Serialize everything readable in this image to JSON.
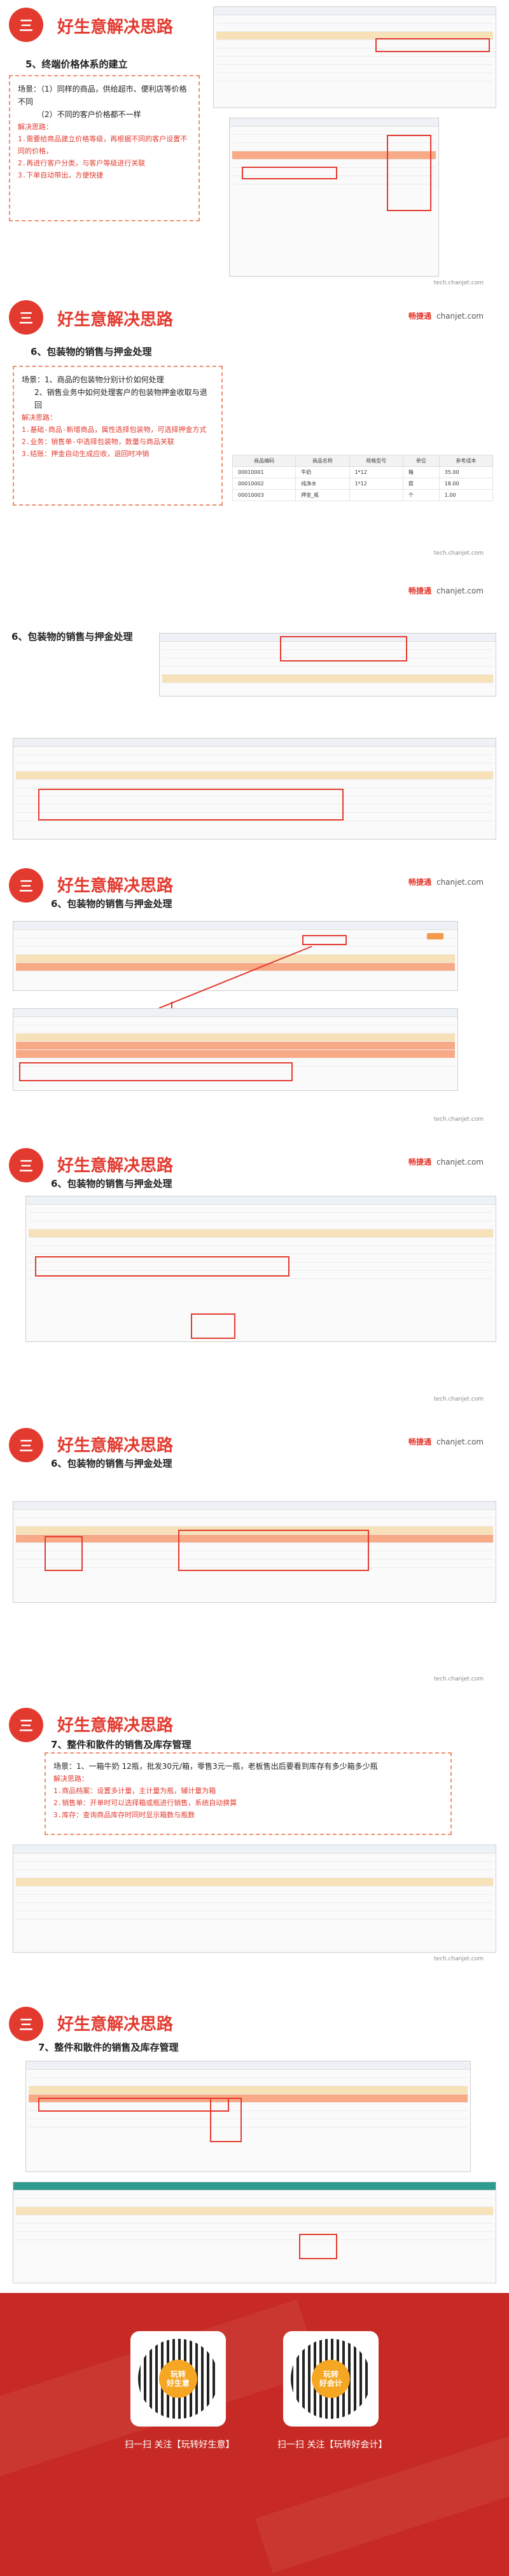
{
  "brand": {
    "name": "畅捷通",
    "site": "chanjet.com",
    "watermark": "tech.chanjet.com"
  },
  "badge_text": "三",
  "section_title": "好生意解决思路",
  "sections": [
    {
      "subtitle": "5、终端价格体系的建立",
      "scene": [
        "场景：（1）同样的商品，供给超市、便利店等价格不同",
        "（2）不同的客户价格都不一样"
      ],
      "method_label": "解决思路：",
      "method": [
        "1.需要给商品建立价格等级，再根据不同的客户设置不同的价格，",
        "2.再进行客户分类，与客户等级进行关联",
        "3.下单自动带出，方便快捷"
      ]
    },
    {
      "subtitle": "6、包装物的销售与押金处理",
      "scene": [
        "场景：1、商品的包装物分别计价如何处理",
        "2、销售业务中如何处理客户的包装物押金收取与退回"
      ],
      "method_label": "解决思路：",
      "method": [
        "1.基础-商品-新增商品，属性选择包装物，可选择押金方式",
        "2.业务：销售单-中选择包装物，数量与商品关联",
        "3.结账：押金自动生成应收，退回时冲销"
      ]
    },
    {
      "subtitle": "6、包装物的销售与押金处理"
    },
    {
      "subtitle": "6、包装物的销售与押金处理"
    },
    {
      "subtitle": "6、包装物的销售与押金处理"
    },
    {
      "subtitle": "6、包装物的销售与押金处理"
    },
    {
      "subtitle": "7、整件和散件的销售及库存管理",
      "scene": [
        "场景：1、一箱牛奶 12瓶，批发30元/箱，零售3元一瓶，老板售出后要看到库存有多少箱多少瓶"
      ],
      "method_label": "解决思路：",
      "method": [
        "1.商品档案：设置多计量，主计量为瓶，辅计量为箱",
        "2.销售单：开单时可以选择箱或瓶进行销售，系统自动换算",
        "3.库存：查询商品库存时同时显示箱数与瓶数"
      ]
    },
    {
      "subtitle": "7、整件和散件的销售及库存管理"
    }
  ],
  "table2": {
    "headers": [
      "商品编码",
      "商品名称",
      "规格型号",
      "单位",
      "参考成本"
    ],
    "rows": [
      [
        "00010001",
        "牛奶",
        "1*12",
        "箱",
        "35.00"
      ],
      [
        "00010002",
        "纯净水",
        "1*12",
        "提",
        "18.00"
      ],
      [
        "00010003",
        "押金_瓶",
        "",
        "个",
        "1.00"
      ]
    ]
  },
  "footer": {
    "qr_left_logo": "玩转\n好生意",
    "qr_right_logo": "玩转\n好会计",
    "caption_left": "扫一扫 关注【玩转好生意】",
    "caption_right": "扫一扫 关注【玩转好会计】"
  }
}
